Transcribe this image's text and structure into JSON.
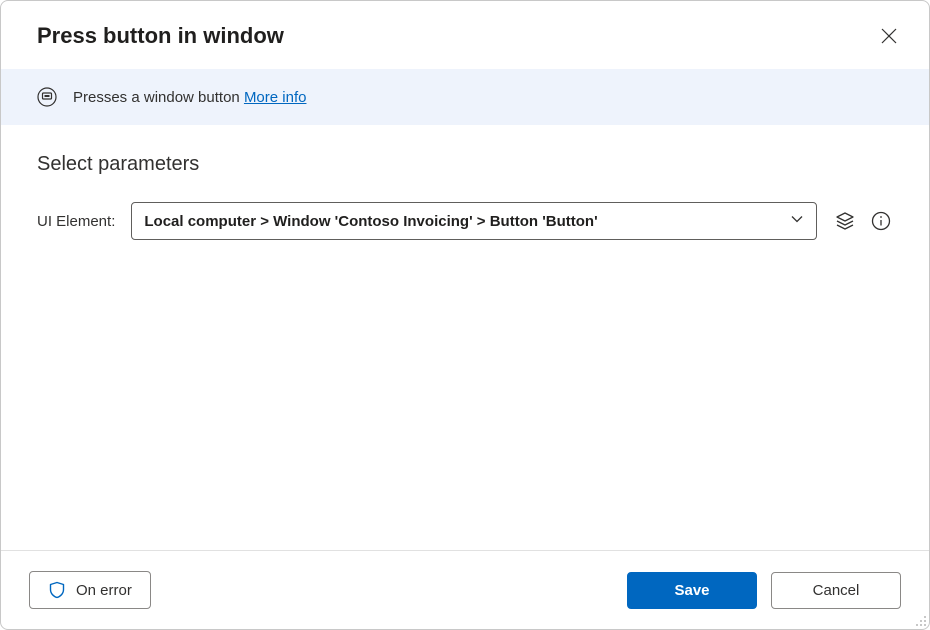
{
  "header": {
    "title": "Press button in window"
  },
  "banner": {
    "description": "Presses a window button",
    "more_info": "More info"
  },
  "content": {
    "section_title": "Select parameters",
    "ui_element_label": "UI Element:",
    "ui_element_value": "Local computer > Window 'Contoso Invoicing' > Button 'Button'"
  },
  "footer": {
    "on_error": "On error",
    "save": "Save",
    "cancel": "Cancel"
  }
}
